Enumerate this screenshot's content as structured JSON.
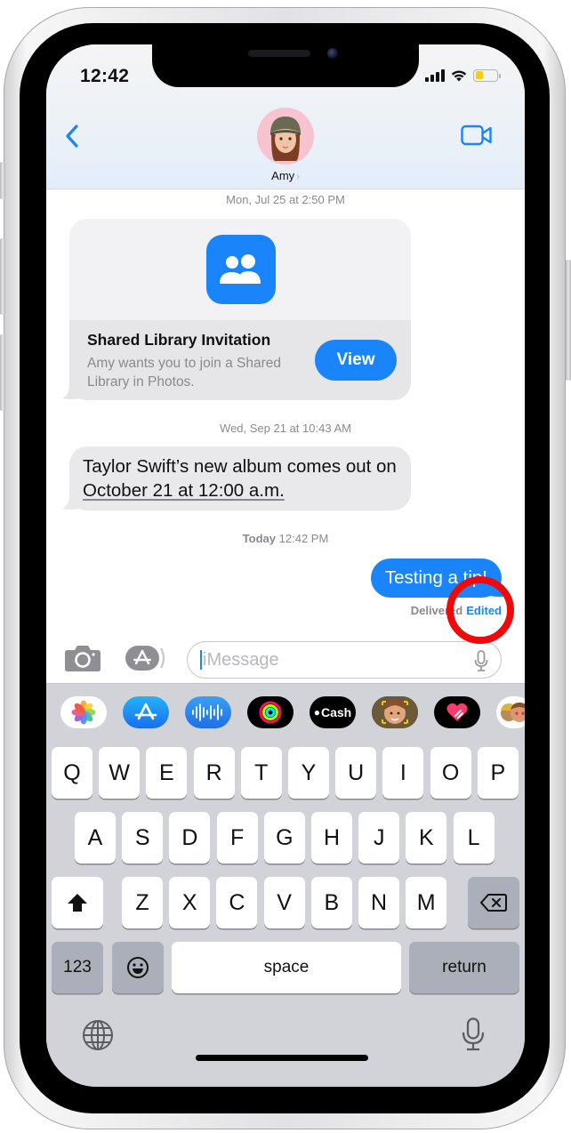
{
  "status_bar": {
    "time": "12:42",
    "battery_color": "#f6cf0b"
  },
  "header": {
    "contact_name": "Amy",
    "contact_chevron": "›",
    "back_icon": "chevron-left-icon",
    "video_icon": "video-camera-icon"
  },
  "colors": {
    "accent": "#1a85fb",
    "highlight_ring": "#ee0a0a",
    "received_bubble": "#e9e9eb"
  },
  "conversation": {
    "timestamp_1": {
      "day": "Mon, Jul 25",
      "time": "at 2:50 PM"
    },
    "shared_library_card": {
      "title": "Shared Library Invitation",
      "description": "Amy wants you to join a Shared Library in Photos.",
      "button_label": "View",
      "icon": "people-icon"
    },
    "timestamp_2": {
      "day": "Wed, Sep 21",
      "time": "at 10:43 AM"
    },
    "received_message": {
      "text_before_link": "Taylor Swift’s new album comes out on ",
      "link_text": "October 21 at 12:00 a.m."
    },
    "timestamp_3": {
      "day": "Today",
      "time": "12:42 PM"
    },
    "sent_message": {
      "text": "Testing a tip!"
    },
    "delivery_status": "Delivered",
    "edited_label": "Edited"
  },
  "input_bar": {
    "placeholder": "iMessage"
  },
  "app_drawer": [
    {
      "name": "photos-app",
      "label": ""
    },
    {
      "name": "app-store-app",
      "label": ""
    },
    {
      "name": "audio-message-app",
      "label": ""
    },
    {
      "name": "fitness-app",
      "label": ""
    },
    {
      "name": "apple-cash-app",
      "label": "Cash"
    },
    {
      "name": "memoji-app",
      "label": ""
    },
    {
      "name": "digital-touch-app",
      "label": ""
    },
    {
      "name": "memoji-stickers-app",
      "label": ""
    }
  ],
  "keyboard": {
    "row1": [
      "Q",
      "W",
      "E",
      "R",
      "T",
      "Y",
      "U",
      "I",
      "O",
      "P"
    ],
    "row2": [
      "A",
      "S",
      "D",
      "F",
      "G",
      "H",
      "J",
      "K",
      "L"
    ],
    "row3": [
      "Z",
      "X",
      "C",
      "V",
      "B",
      "N",
      "M"
    ],
    "numbers_label": "123",
    "space_label": "space",
    "return_label": "return"
  }
}
